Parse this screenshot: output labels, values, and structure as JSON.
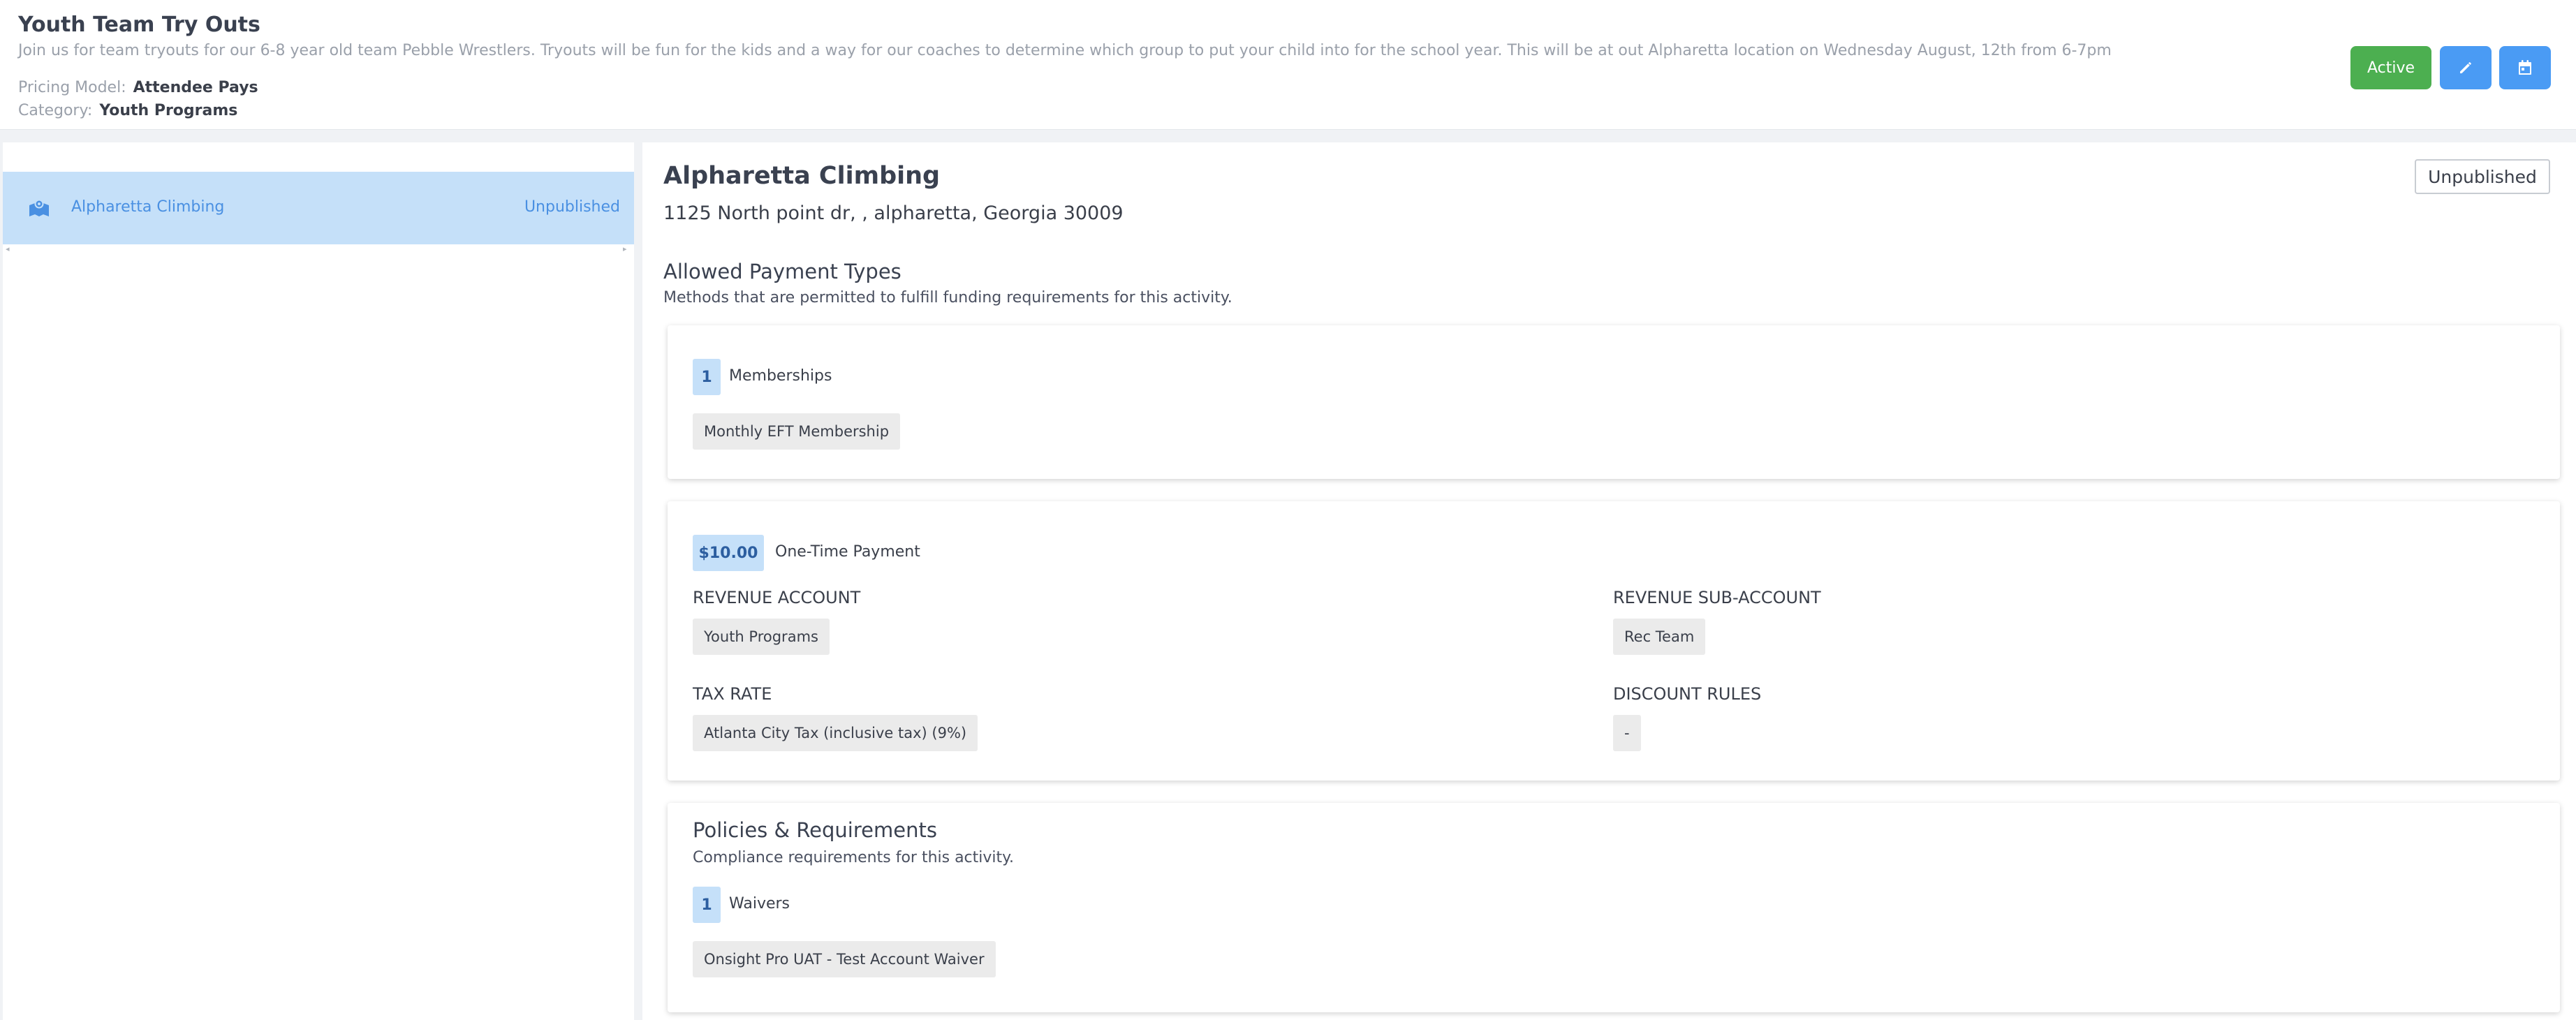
{
  "header": {
    "title": "Youth Team Try Outs",
    "description": "Join us for team tryouts for our 6-8 year old team Pebble Wrestlers. Tryouts will be fun for the kids and a way for our coaches to determine which group to put your child into for the school year. This will be at out Alpharetta location on Wednesday August, 12th from 6-7pm",
    "pricing_label": "Pricing Model:",
    "pricing_value": "Attendee Pays",
    "category_label": "Category:",
    "category_value": "Youth Programs",
    "active_button": "Active",
    "edit_icon": "pencil-icon",
    "calendar_icon": "calendar-icon"
  },
  "sidebar": {
    "items": [
      {
        "icon": "map-icon",
        "label": "Alpharetta Climbing",
        "status": "Unpublished"
      }
    ]
  },
  "location": {
    "title": "Alpharetta Climbing",
    "status": "Unpublished",
    "address": "1125 North point dr, , alpharetta, Georgia 30009",
    "payment_types": {
      "title": "Allowed Payment Types",
      "subtitle": "Methods that are permitted to fulfill funding requirements for this activity.",
      "memberships": {
        "count": "1",
        "label": "Memberships",
        "items": [
          "Monthly EFT Membership"
        ]
      },
      "one_time": {
        "amount": "$10.00",
        "label": "One-Time Payment",
        "revenue_account_label": "REVENUE ACCOUNT",
        "revenue_account_value": "Youth Programs",
        "revenue_sub_account_label": "REVENUE SUB-ACCOUNT",
        "revenue_sub_account_value": "Rec Team",
        "tax_rate_label": "TAX RATE",
        "tax_rate_value": "Atlanta City Tax (inclusive tax) (9%)",
        "discount_rules_label": "DISCOUNT RULES",
        "discount_rules_value": "-"
      }
    },
    "policies": {
      "title": "Policies & Requirements",
      "subtitle": "Compliance requirements for this activity.",
      "waivers": {
        "count": "1",
        "label": "Waivers",
        "items": [
          "Onsight Pro UAT - Test Account Waiver"
        ]
      }
    }
  },
  "colors": {
    "active_green": "#4caf50",
    "action_blue": "#4a9bf4",
    "highlight_blue": "#c5e0f9",
    "link_blue": "#4a90e2"
  }
}
